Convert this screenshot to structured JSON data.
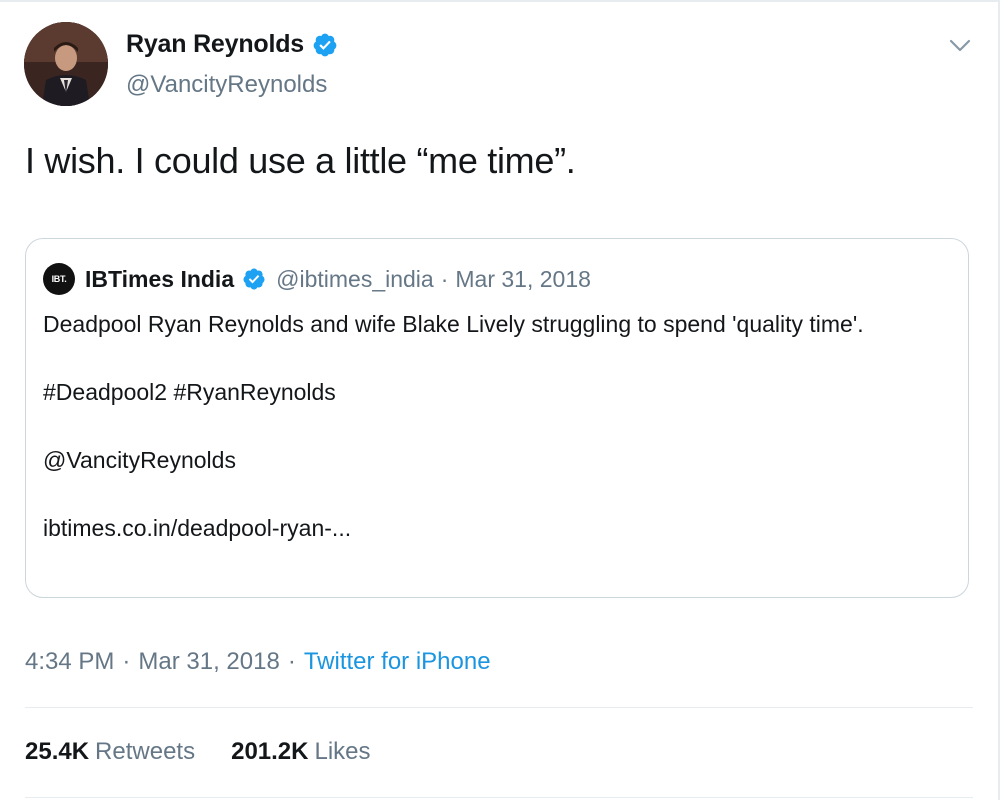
{
  "tweet": {
    "author": {
      "name": "Ryan Reynolds",
      "handle": "@VancityReynolds",
      "verified": true
    },
    "text": "I wish. I could use a little “me time”.",
    "quoted": {
      "logo_text": "IBT.",
      "name": "IBTimes India",
      "verified": true,
      "handle": "@ibtimes_india",
      "separator": "·",
      "date": "Mar 31, 2018",
      "body": [
        "Deadpool Ryan Reynolds and wife Blake Lively struggling to spend 'quality time'.",
        "#Deadpool2 #RyanReynolds",
        "@VancityReynolds"
      ],
      "link": "ibtimes.co.in/deadpool-ryan-..."
    },
    "meta": {
      "time": "4:34 PM",
      "separator": "·",
      "date": "Mar 31, 2018",
      "source": "Twitter for iPhone"
    },
    "stats": {
      "retweets_count": "25.4K",
      "retweets_label": "Retweets",
      "likes_count": "201.2K",
      "likes_label": "Likes"
    }
  },
  "icons": {
    "verified": "verified-badge-icon",
    "caret": "chevron-down-icon"
  },
  "colors": {
    "verified_blue": "#1da1f2",
    "link_blue": "#1b95e0",
    "secondary_text": "#657786",
    "border": "#ccd6dd"
  }
}
